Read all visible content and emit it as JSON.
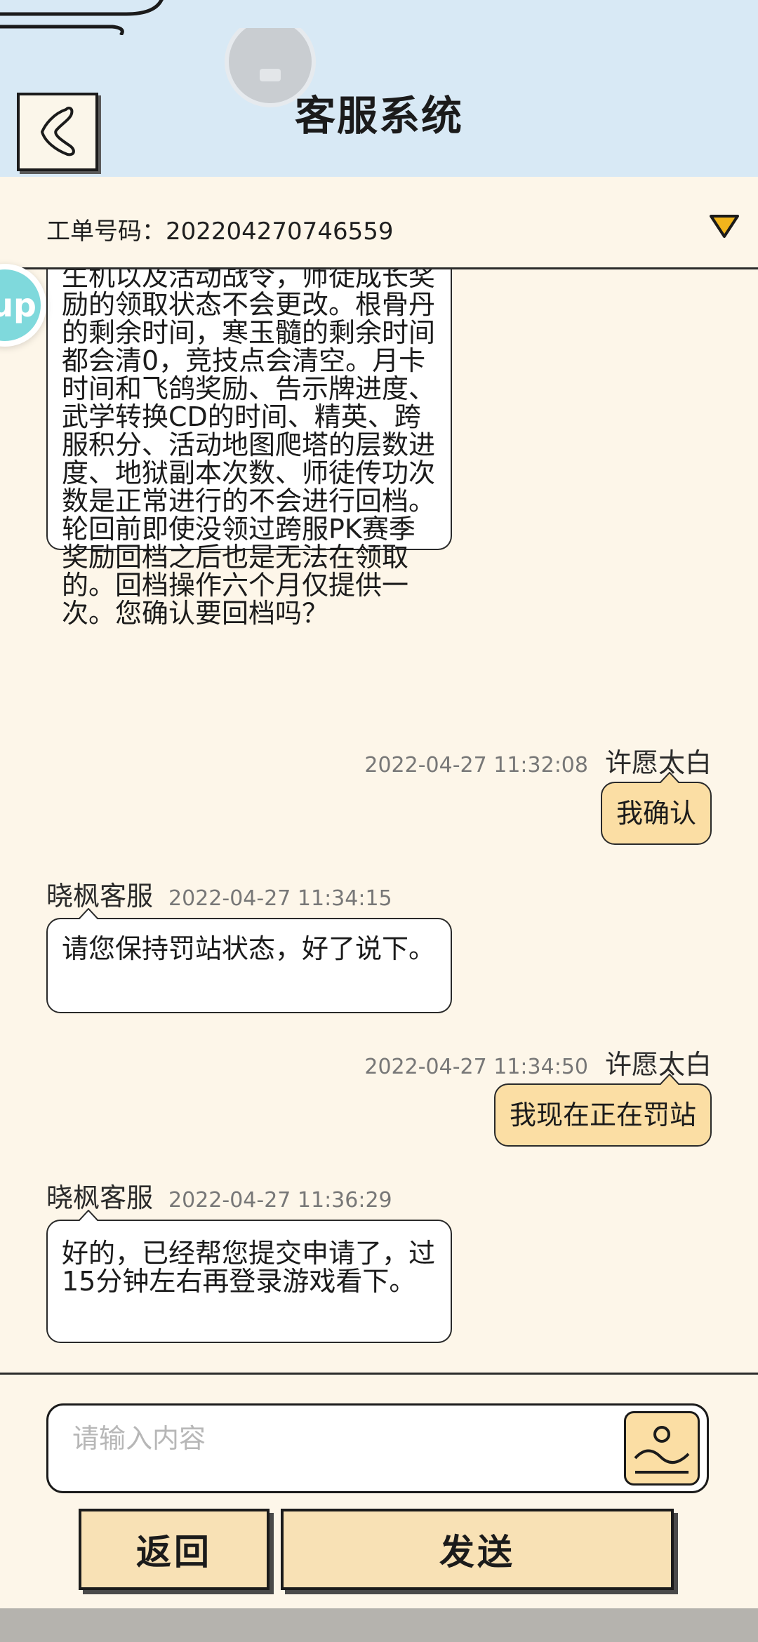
{
  "header": {
    "title": "客服系统"
  },
  "ticket": {
    "label": "工单号码：",
    "number": "202204270746559"
  },
  "badge": {
    "text": "up"
  },
  "messages": [
    {
      "side": "left",
      "text": "生机以及活动战令，师徒成长奖励的领取状态不会更改。根骨丹的剩余时间，寒玉髓的剩余时间都会清0，竞技点会清空。月卡时间和飞鸽奖励、告示牌进度、武学转换CD的时间、精英、跨服积分、活动地图爬塔的层数进度、地狱副本次数、师徒传功次数是正常进行的不会进行回档。轮回前即使没领过跨服PK赛季奖励回档之后也是无法在领取的。回档操作六个月仅提供一次。您确认要回档吗？"
    },
    {
      "side": "right",
      "name": "许愿太白",
      "time": "2022-04-27 11:32:08",
      "text": "我确认"
    },
    {
      "side": "left",
      "name": "晓枫客服",
      "time": "2022-04-27 11:34:15",
      "text": "请您保持罚站状态，好了说下。"
    },
    {
      "side": "right",
      "name": "许愿太白",
      "time": "2022-04-27 11:34:50",
      "text": "我现在正在罚站"
    },
    {
      "side": "left",
      "name": "晓枫客服",
      "time": "2022-04-27 11:36:29",
      "text": "好的，已经帮您提交申请了，过15分钟左右再登录游戏看下。"
    }
  ],
  "input": {
    "placeholder": "请输入内容"
  },
  "buttons": {
    "back": "返回",
    "send": "发送"
  },
  "colors": {
    "header_bg": "#d8e9f5",
    "page_bg": "#fdf6e9",
    "user_bubble": "#fbdea4",
    "button_bg": "#f8e1b5",
    "dropdown": "#f2b51c"
  }
}
